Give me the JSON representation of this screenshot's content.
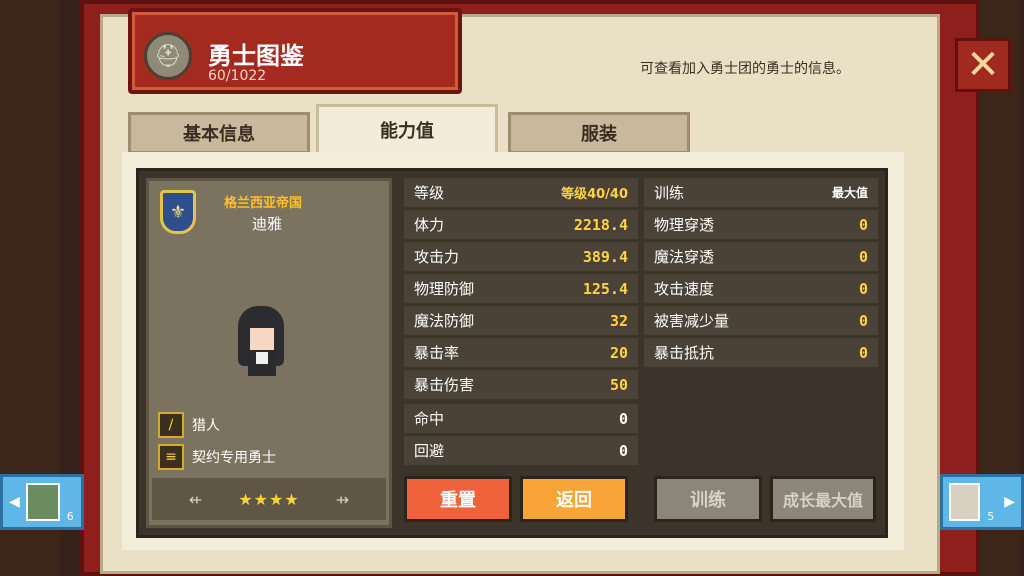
{
  "header": {
    "title": "勇士图鉴",
    "count": "60/1022",
    "description": "可查看加入勇士团的勇士的信息。"
  },
  "tabs": [
    {
      "label": "基本信息",
      "active": false
    },
    {
      "label": "能力值",
      "active": true
    },
    {
      "label": "服装",
      "active": false
    }
  ],
  "hero": {
    "empire": "格兰西亚帝国",
    "name": "迪雅",
    "class": "猎人",
    "type": "契约专用勇士",
    "stars": "★★★★",
    "star_count": 4
  },
  "stats_left": [
    {
      "label": "等级",
      "value": "等级40/40"
    },
    {
      "label": "体力",
      "value": "2218.4"
    },
    {
      "label": "攻击力",
      "value": "389.4"
    },
    {
      "label": "物理防御",
      "value": "125.4"
    },
    {
      "label": "魔法防御",
      "value": "32"
    },
    {
      "label": "暴击率",
      "value": "20"
    },
    {
      "label": "暴击伤害",
      "value": "50"
    },
    {
      "label": "命中",
      "value": "0"
    },
    {
      "label": "回避",
      "value": "0"
    }
  ],
  "stats_right": [
    {
      "label": "训练",
      "value": "最大值"
    },
    {
      "label": "物理穿透",
      "value": "0"
    },
    {
      "label": "魔法穿透",
      "value": "0"
    },
    {
      "label": "攻击速度",
      "value": "0"
    },
    {
      "label": "被害减少量",
      "value": "0"
    },
    {
      "label": "暴击抵抗",
      "value": "0"
    }
  ],
  "buttons": {
    "reset": "重置",
    "back": "返回",
    "train": "训练",
    "growth_max": "成长最大值"
  },
  "nav": {
    "prev_level": "6",
    "next_level": "5"
  },
  "icons": {
    "close": "close-icon",
    "helmet": "helmet-icon",
    "emblem": "emblem-icon"
  },
  "colors": {
    "reset_button": "#f0623c",
    "back_button": "#f7a536",
    "disabled_button": "#8c857a",
    "stat_value": "#ffd24a"
  }
}
